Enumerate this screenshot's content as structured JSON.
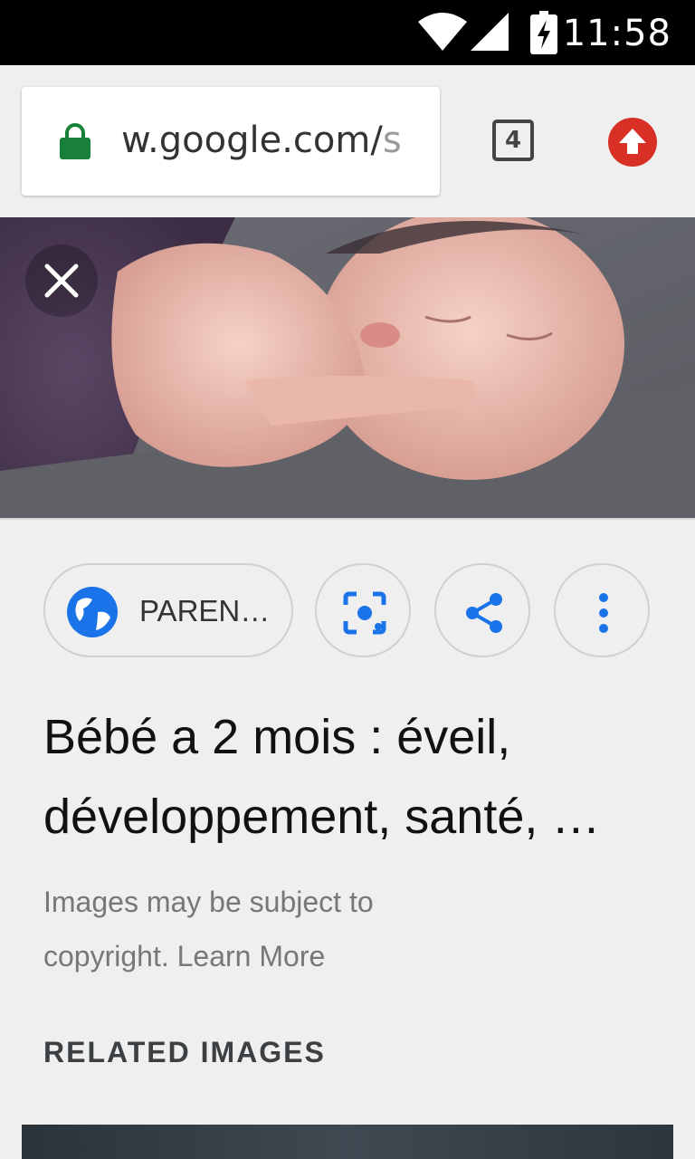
{
  "status_bar": {
    "time": "11:58",
    "icons": [
      "wifi-icon",
      "cell-signal-icon",
      "battery-charging-icon"
    ]
  },
  "browser": {
    "url_main": "w.google.com/",
    "url_faded": "s",
    "tab_count": "4",
    "lock_color": "#188038",
    "update_color": "#d93025"
  },
  "image_viewer": {
    "close_icon": "close-icon",
    "source_chip": {
      "label": "PAREN…",
      "icon": "globe-icon"
    },
    "actions": [
      "lens-icon",
      "share-icon",
      "more-vert-icon"
    ],
    "title": "Bébé a 2 mois : éveil, développement, santé, …",
    "copyright_prefix": "Images may be subject to copyright.",
    "learn_more": "Learn More",
    "related_heading": "RELATED IMAGES",
    "accent_color": "#1a73e8"
  }
}
